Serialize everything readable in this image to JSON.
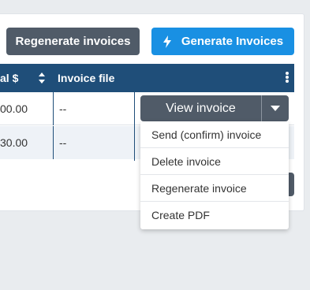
{
  "toolbar": {
    "regenerate_label": "Regenerate invoices",
    "generate_label": "Generate Invoices"
  },
  "table": {
    "headers": {
      "total": "al $",
      "invoice_file": "Invoice file"
    },
    "rows": [
      {
        "total": "00.00",
        "invoice_file": "--"
      },
      {
        "total": "30.00",
        "invoice_file": "--"
      }
    ]
  },
  "action": {
    "view_label": "View invoice"
  },
  "menu": {
    "items": [
      {
        "label": "Send (confirm) invoice"
      },
      {
        "label": "Delete invoice"
      },
      {
        "label": "Regenerate invoice"
      },
      {
        "label": "Create PDF"
      }
    ]
  },
  "colors": {
    "header": "#1f4e79",
    "primary": "#1990e3",
    "secondary": "#505b68"
  },
  "icons": [
    "lightning-bolt-icon",
    "sort-icon",
    "kebab-menu-icon",
    "caret-down-icon"
  ]
}
